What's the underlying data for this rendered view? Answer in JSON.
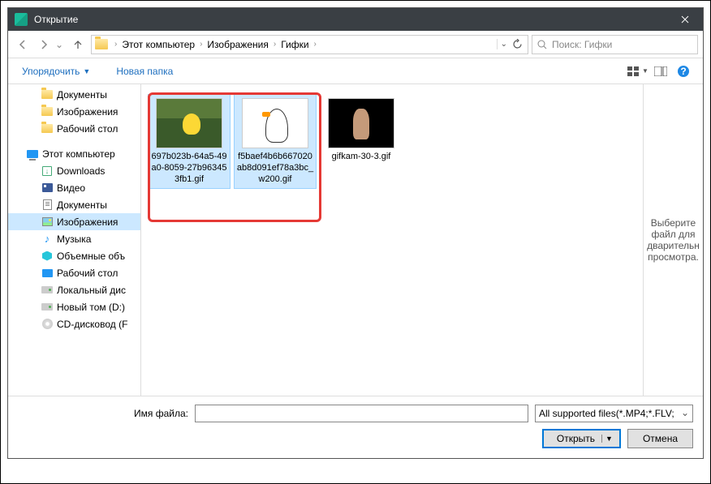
{
  "title": "Открытие",
  "breadcrumb": {
    "b0": "Этот компьютер",
    "b1": "Изображения",
    "b2": "Гифки"
  },
  "search": {
    "placeholder": "Поиск: Гифки"
  },
  "toolbar": {
    "organize": "Упорядочить",
    "newfolder": "Новая папка"
  },
  "sidebar": {
    "i0": "Документы",
    "i1": "Изображения",
    "i2": "Рабочий стол",
    "i3": "Этот компьютер",
    "i4": "Downloads",
    "i5": "Видео",
    "i6": "Документы",
    "i7": "Изображения",
    "i8": "Музыка",
    "i9": "Объемные объ",
    "i10": "Рабочий стол",
    "i11": "Локальный дис",
    "i12": "Новый том (D:)",
    "i13": "CD-дисковод (F"
  },
  "files": {
    "f0": "697b023b-64a5-49a0-8059-27b963453fb1.gif",
    "f1": "f5baef4b6b667020ab8d091ef78a3bc_w200.gif",
    "f2": "gifkam-30-3.gif"
  },
  "preview": {
    "text": "Выберите файл для дварительн просмотра."
  },
  "footer": {
    "fname_label": "Имя файла:",
    "filter": "All supported files(*.MP4;*.FLV;",
    "open": "Открыть",
    "cancel": "Отмена"
  }
}
